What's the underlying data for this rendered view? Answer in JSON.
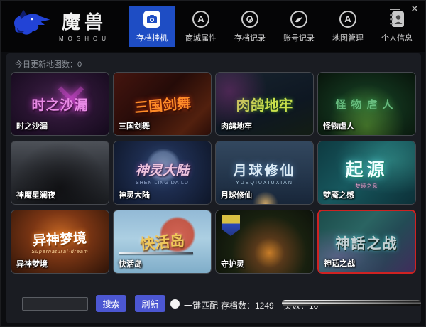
{
  "window": {
    "logo_title": "魔兽",
    "logo_subtitle": "MOSHOU",
    "minimize": "—",
    "close": "✕"
  },
  "nav": {
    "tabs": [
      {
        "label": "存档挂机",
        "icon": "save-camera-icon",
        "active": true
      },
      {
        "label": "商城属性",
        "icon": "a-circle-icon",
        "active": false
      },
      {
        "label": "存档记录",
        "icon": "spiral-circle-icon",
        "active": false
      },
      {
        "label": "账号记录",
        "icon": "bird-circle-icon",
        "active": false
      },
      {
        "label": "地图管理",
        "icon": "app-a-circle-icon",
        "active": false
      },
      {
        "label": "个人信息",
        "icon": "contacts-book-icon",
        "active": false
      }
    ]
  },
  "stats": {
    "today_updated": "今日更新地图数：0"
  },
  "cards": [
    {
      "label": "时之沙漏",
      "art_title": "时之沙漏",
      "art_subtitle": ""
    },
    {
      "label": "三国剑舞",
      "art_title": "三国剑舞",
      "art_subtitle": ""
    },
    {
      "label": "肉鸽地牢",
      "art_title": "肉鸽地牢",
      "art_subtitle": ""
    },
    {
      "label": "怪物虐人",
      "art_title": "怪物虐人",
      "art_subtitle": ""
    },
    {
      "label": "神魔星澜夜",
      "art_title": "",
      "art_subtitle": ""
    },
    {
      "label": "神灵大陆",
      "art_title": "神灵大陆",
      "art_subtitle": "SHEN LING DA LU"
    },
    {
      "label": "月球修仙",
      "art_title": "月球修仙",
      "art_subtitle": "YUEQIUXIUXIAN"
    },
    {
      "label": "梦魇之感",
      "art_title": "起源",
      "art_subtitle": "梦境之息"
    },
    {
      "label": "异神梦境",
      "art_title": "异神梦境",
      "art_subtitle": "Supernatural·dream"
    },
    {
      "label": "快活岛",
      "art_title": "快活岛",
      "art_subtitle": ""
    },
    {
      "label": "守护灵",
      "art_title": "",
      "art_subtitle": ""
    },
    {
      "label": "神话之战",
      "art_title": "神話之战",
      "art_subtitle": "",
      "selected": true
    }
  ],
  "footer": {
    "search_value": "",
    "search_button": "搜索",
    "refresh_button": "刷新",
    "match_label": "一键匹配",
    "archive_count": "存档数：1249",
    "page_count": "页数：10"
  },
  "colors": {
    "active_tab_blue": "#1e4dc4",
    "button_indigo": "#4c57d2",
    "selected_card_border": "#cf2222",
    "logo_blue": "#2243d6",
    "panel_background": "#1a1c22"
  }
}
